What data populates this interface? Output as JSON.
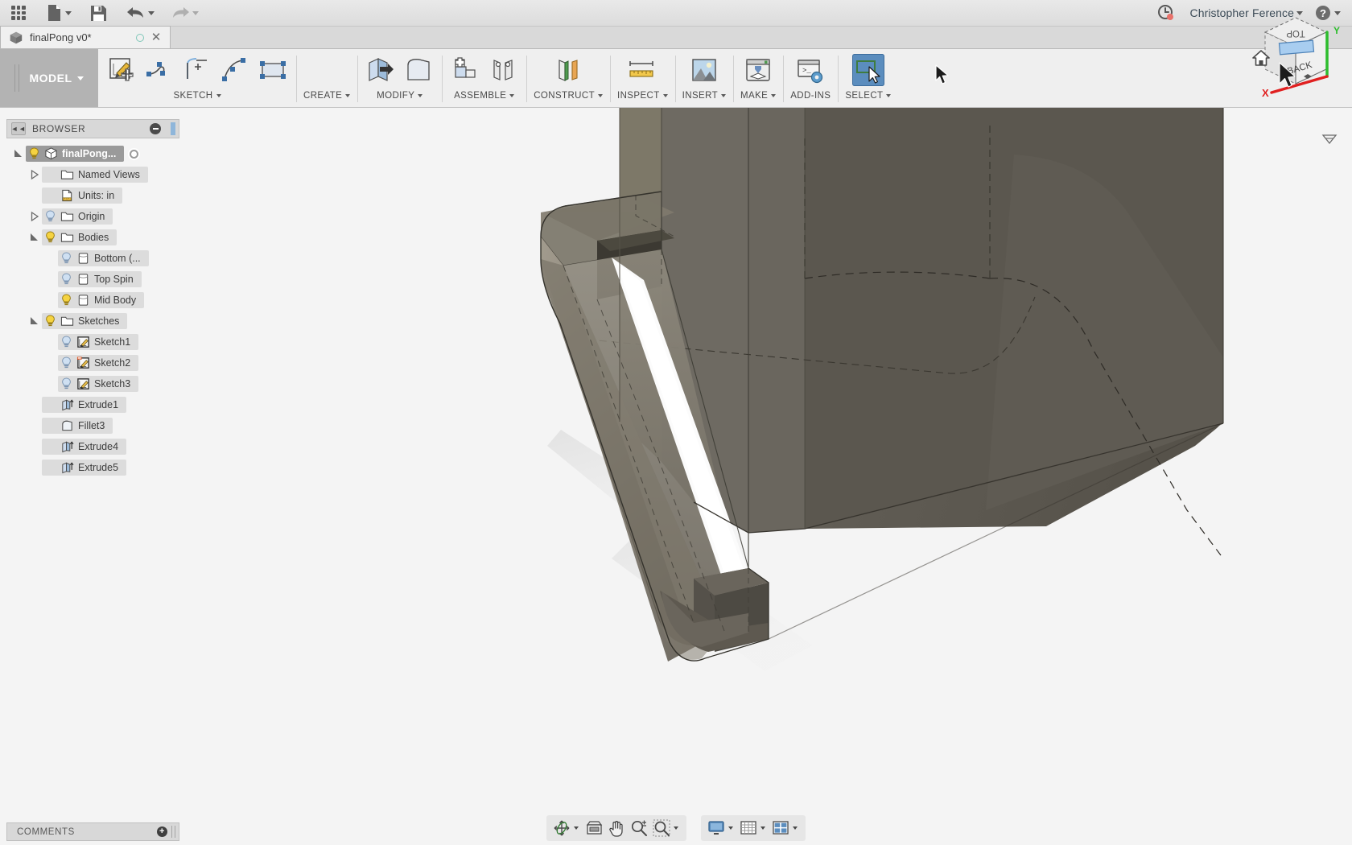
{
  "app": {
    "title_bar": {
      "apps_grid_icon": "apps-grid-icon",
      "new_file_icon": "new-file-icon",
      "save_icon": "save-icon",
      "undo_icon": "undo-icon",
      "redo_icon": "redo-icon",
      "job_status_icon": "job-status-clock-icon",
      "user_name": "Christopher Ference",
      "help_icon": "help-question-icon"
    },
    "document_tab": {
      "icon": "document-cube-icon",
      "title": "finalPong v0*",
      "unsaved_dot": "unsaved-indicator",
      "close_label": "✕"
    }
  },
  "ribbon": {
    "workspace": {
      "label": "MODEL"
    },
    "groups": [
      {
        "id": "sketch",
        "label": "SKETCH",
        "has_caret": true,
        "tools": [
          "create-sketch-icon",
          "line-icon",
          "arc-icon",
          "spline-icon",
          "rectangle-icon"
        ]
      },
      {
        "id": "create",
        "label": "CREATE",
        "has_caret": true,
        "tools": []
      },
      {
        "id": "modify",
        "label": "MODIFY",
        "has_caret": true,
        "tools": [
          "extrude-press-pull-icon",
          "fillet-icon"
        ]
      },
      {
        "id": "assemble",
        "label": "ASSEMBLE",
        "has_caret": true,
        "tools": [
          "new-component-icon",
          "joint-icon"
        ]
      },
      {
        "id": "construct",
        "label": "CONSTRUCT",
        "has_caret": true,
        "tools": [
          "offset-plane-icon"
        ]
      },
      {
        "id": "inspect",
        "label": "INSPECT",
        "has_caret": true,
        "tools": [
          "measure-ruler-icon"
        ]
      },
      {
        "id": "insert",
        "label": "INSERT",
        "has_caret": true,
        "tools": [
          "insert-image-icon"
        ]
      },
      {
        "id": "make",
        "label": "MAKE",
        "has_caret": true,
        "tools": [
          "3d-print-icon"
        ]
      },
      {
        "id": "addins",
        "label": "ADD-INS",
        "has_caret": false,
        "tools": [
          "scripts-addins-icon"
        ]
      },
      {
        "id": "select",
        "label": "SELECT",
        "has_caret": true,
        "active": true,
        "tools": [
          "select-window-icon"
        ]
      }
    ]
  },
  "browser": {
    "header": {
      "title": "BROWSER",
      "collapse_icon": "collapse-left-icon",
      "minus_icon": "minus-circle-icon"
    },
    "tree": [
      {
        "id": "root",
        "label": "finalPong...",
        "depth": 0,
        "twist": "open",
        "bulb": "on",
        "icon": "component-cube-icon",
        "selected": true,
        "radio": true
      },
      {
        "id": "named-views",
        "label": "Named Views",
        "depth": 1,
        "twist": "closed",
        "bulb": "none",
        "icon": "folder-icon",
        "selected": false,
        "radio": false
      },
      {
        "id": "units",
        "label": "Units: in",
        "depth": 1,
        "twist": "none",
        "bulb": "none",
        "icon": "document-ruler-icon",
        "selected": false,
        "radio": false
      },
      {
        "id": "origin",
        "label": "Origin",
        "depth": 1,
        "twist": "closed",
        "bulb": "off",
        "icon": "folder-icon",
        "selected": false,
        "radio": false
      },
      {
        "id": "bodies",
        "label": "Bodies",
        "depth": 1,
        "twist": "open",
        "bulb": "on",
        "icon": "folder-icon",
        "selected": false,
        "radio": false
      },
      {
        "id": "bottom",
        "label": "Bottom (...",
        "depth": 2,
        "twist": "none",
        "bulb": "off",
        "icon": "body-icon",
        "selected": false,
        "radio": false
      },
      {
        "id": "top-spin",
        "label": "Top Spin",
        "depth": 2,
        "twist": "none",
        "bulb": "off",
        "icon": "body-icon",
        "selected": false,
        "radio": false
      },
      {
        "id": "mid-body",
        "label": "Mid Body",
        "depth": 2,
        "twist": "none",
        "bulb": "on",
        "icon": "body-icon",
        "selected": false,
        "radio": false
      },
      {
        "id": "sketches",
        "label": "Sketches",
        "depth": 1,
        "twist": "open",
        "bulb": "on",
        "icon": "folder-icon",
        "selected": false,
        "radio": false
      },
      {
        "id": "sketch1",
        "label": "Sketch1",
        "depth": 2,
        "twist": "none",
        "bulb": "off",
        "icon": "sketch-icon",
        "selected": false,
        "radio": false
      },
      {
        "id": "sketch2",
        "label": "Sketch2",
        "depth": 2,
        "twist": "none",
        "bulb": "off",
        "icon": "sketch-warn-icon",
        "selected": false,
        "radio": false
      },
      {
        "id": "sketch3",
        "label": "Sketch3",
        "depth": 2,
        "twist": "none",
        "bulb": "off",
        "icon": "sketch-icon",
        "selected": false,
        "radio": false
      },
      {
        "id": "extrude1",
        "label": "Extrude1",
        "depth": 1,
        "twist": "none",
        "bulb": "none",
        "icon": "extrude-feature-icon",
        "selected": false,
        "radio": false
      },
      {
        "id": "fillet3",
        "label": "Fillet3",
        "depth": 1,
        "twist": "none",
        "bulb": "none",
        "icon": "fillet-feature-icon",
        "selected": false,
        "radio": false
      },
      {
        "id": "extrude4",
        "label": "Extrude4",
        "depth": 1,
        "twist": "none",
        "bulb": "none",
        "icon": "extrude-feature-icon",
        "selected": false,
        "radio": false
      },
      {
        "id": "extrude5",
        "label": "Extrude5",
        "depth": 1,
        "twist": "none",
        "bulb": "none",
        "icon": "extrude-feature-icon",
        "selected": false,
        "radio": false
      }
    ]
  },
  "comments": {
    "label": "COMMENTS",
    "add_icon": "add-comment-icon"
  },
  "viewcube": {
    "home_icon": "home-view-icon",
    "menu_icon": "viewcube-menu-icon",
    "face_top": "TOP",
    "face_front": "BACK",
    "axis_x": "X",
    "axis_y": "Y",
    "highlight_color": "#a8cdf0"
  },
  "navbar": {
    "group1": [
      {
        "id": "orbit",
        "icon": "orbit-icon",
        "caret": true
      },
      {
        "id": "look-at",
        "icon": "look-at-icon",
        "caret": false
      },
      {
        "id": "pan",
        "icon": "pan-hand-icon",
        "caret": false
      },
      {
        "id": "zoom",
        "icon": "zoom-icon",
        "caret": false
      },
      {
        "id": "fit",
        "icon": "zoom-window-icon",
        "caret": true
      }
    ],
    "group2": [
      {
        "id": "display-settings",
        "icon": "display-settings-icon",
        "caret": true
      },
      {
        "id": "grid-snaps",
        "icon": "grid-snaps-icon",
        "caret": true
      },
      {
        "id": "viewports",
        "icon": "viewports-icon",
        "caret": true
      }
    ]
  },
  "colors": {
    "ribbon_bg": "#efefef",
    "canvas_bg": "#f4f4f4",
    "accent_blue": "#5b8dbe",
    "model_body": "#57534b",
    "model_light": "#8b857a",
    "axis_x": "#e02020",
    "axis_y": "#2dbd2d",
    "tree_selected": "#9a9a9a"
  }
}
